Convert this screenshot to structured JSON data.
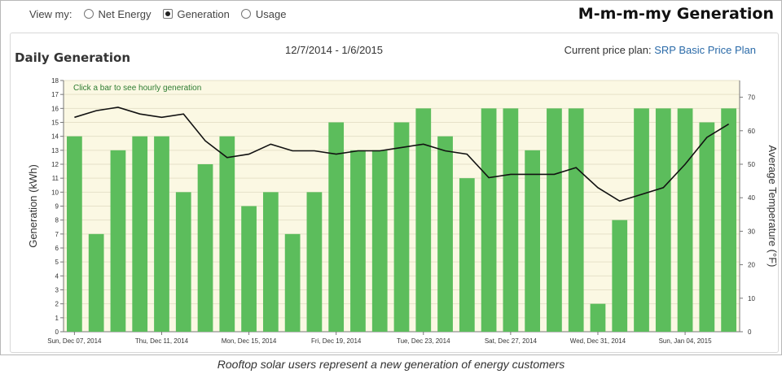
{
  "view_selector": {
    "label": "View my:",
    "options": [
      {
        "label": "Net Energy",
        "selected": false
      },
      {
        "label": "Generation",
        "selected": true
      },
      {
        "label": "Usage",
        "selected": false
      }
    ]
  },
  "headline": "M-m-m-my Generation",
  "panel": {
    "title": "Daily Generation",
    "date_range": "12/7/2014 - 1/6/2015",
    "price_plan_label": "Current price plan:",
    "price_plan_link": "SRP Basic Price Plan"
  },
  "caption": "Rooftop solar users represent a new generation of energy customers",
  "chart_data": {
    "type": "bar",
    "hint": "Click a bar to see hourly generation",
    "ylabel": "Generation (kWh)",
    "y2label": "Average Temperature (°F)",
    "ylim": [
      0,
      18
    ],
    "y2lim": [
      0,
      75
    ],
    "y_ticks": [
      0,
      1,
      2,
      3,
      4,
      5,
      6,
      7,
      8,
      9,
      10,
      11,
      12,
      13,
      14,
      15,
      16,
      17,
      18
    ],
    "y2_ticks": [
      0,
      10,
      20,
      30,
      40,
      50,
      60,
      70
    ],
    "x_tick_labels": [
      {
        "index": 0,
        "label": "Sun, Dec 07, 2014"
      },
      {
        "index": 4,
        "label": "Thu, Dec 11, 2014"
      },
      {
        "index": 8,
        "label": "Mon, Dec 15, 2014"
      },
      {
        "index": 12,
        "label": "Fri, Dec 19, 2014"
      },
      {
        "index": 16,
        "label": "Tue, Dec 23, 2014"
      },
      {
        "index": 20,
        "label": "Sat, Dec 27, 2014"
      },
      {
        "index": 24,
        "label": "Wed, Dec 31, 2014"
      },
      {
        "index": 28,
        "label": "Sun, Jan 04, 2015"
      }
    ],
    "series": [
      {
        "type": "bar",
        "color": "#5cbd5c",
        "values": [
          14,
          7,
          13,
          14,
          14,
          10,
          12,
          14,
          9,
          10,
          7,
          10,
          15,
          13,
          13,
          15,
          16,
          14,
          11,
          16,
          16,
          13,
          16,
          16,
          2,
          8,
          16,
          16,
          16,
          15,
          16
        ]
      },
      {
        "type": "line",
        "axis": "right",
        "color": "#111111",
        "values": [
          64,
          66,
          67,
          65,
          64,
          65,
          57,
          52,
          53,
          56,
          54,
          54,
          53,
          54,
          54,
          55,
          56,
          54,
          53,
          46,
          47,
          47,
          47,
          49,
          43,
          39,
          41,
          43,
          50,
          58,
          62
        ]
      }
    ],
    "grid": true,
    "plot_background": "#fbf8e3"
  }
}
